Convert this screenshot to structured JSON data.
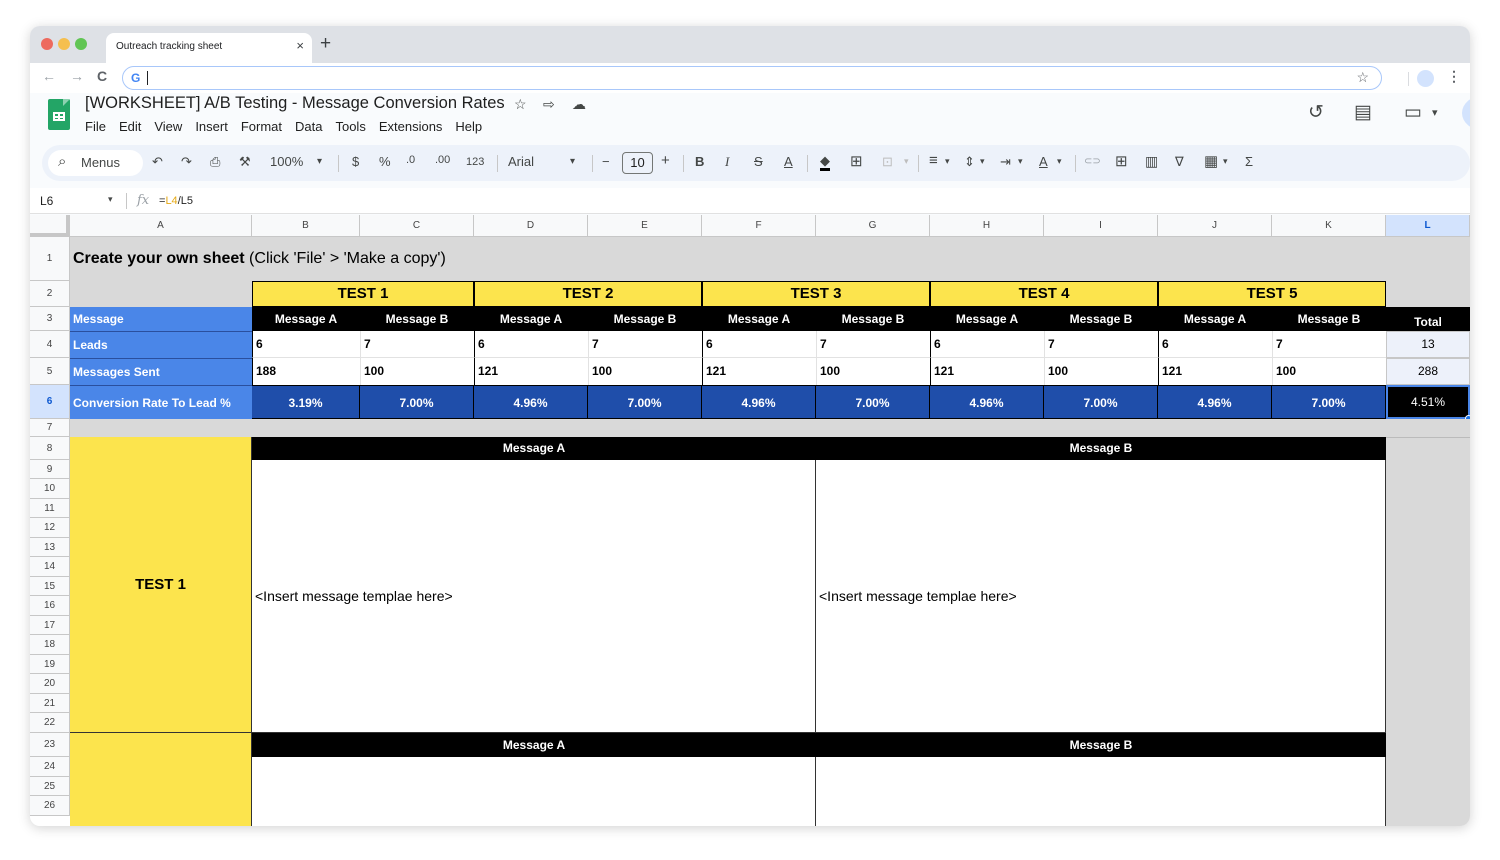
{
  "browser": {
    "tab_title": "Outreach tracking sheet",
    "tab_close": "×",
    "new_tab": "+",
    "back": "←",
    "forward": "→",
    "reload": "C",
    "omnibox_logo": "G",
    "omnibox_value": "",
    "bookmark_star": "☆",
    "menu": "⋮"
  },
  "header": {
    "doc_title": "[WORKSHEET] A/B Testing - Message Conversion Rates",
    "star_icon": "☆",
    "move_icon": "⇨",
    "cloud_icon": "☁",
    "menus": [
      "File",
      "Edit",
      "View",
      "Insert",
      "Format",
      "Data",
      "Tools",
      "Extensions",
      "Help"
    ],
    "history_icon": "↺",
    "comments_icon": "▤",
    "meet_icon": "▭",
    "meet_dropdown": "▾"
  },
  "toolbar": {
    "search_label": "Menus",
    "search_icon": "⌕",
    "undo": "↶",
    "redo": "↷",
    "print": "⎙",
    "paint_format": "⚒",
    "zoom": "100%",
    "dropdown": "▾",
    "currency": "$",
    "percent": "%",
    "decrease_decimal": ".0",
    "increase_decimal": ".00",
    "more_formats": "123",
    "font": "Arial",
    "font_size_decrease": "−",
    "font_size": "10",
    "font_size_increase": "+",
    "bold": "B",
    "italic": "I",
    "strikethrough": "S",
    "text_color": "A",
    "fill_color": "◆",
    "borders": "⊞",
    "merge": "⊡",
    "h_align": "≡",
    "v_align": "⇕",
    "wrap": "⇥",
    "rotate": "A",
    "link": "⊂⊃",
    "comment": "⊞",
    "chart": "▥",
    "filter": "∇",
    "views": "▦",
    "functions": "Σ"
  },
  "formula_bar": {
    "cell_ref": "L6",
    "dropdown": "▾",
    "fx": "fx",
    "formula_eq": "=",
    "formula_ref1": "L4",
    "formula_rest": "/L5"
  },
  "sheet": {
    "columns": [
      "A",
      "B",
      "C",
      "D",
      "E",
      "F",
      "G",
      "H",
      "I",
      "J",
      "K",
      "L"
    ],
    "selected_column": "L",
    "rows": [
      "1",
      "2",
      "3",
      "4",
      "5",
      "6",
      "7",
      "8",
      "9",
      "10",
      "11",
      "12",
      "13",
      "14",
      "15",
      "16",
      "17",
      "18",
      "19",
      "20",
      "21",
      "22",
      "23",
      "24",
      "25",
      "26"
    ],
    "selected_row": "6",
    "title_bold": "Create your own sheet",
    "title_rest": " (Click 'File' > 'Make a copy')",
    "tests": [
      "TEST 1",
      "TEST 2",
      "TEST 3",
      "TEST 4",
      "TEST 5"
    ],
    "row_labels": {
      "message": "Message",
      "leads": "Leads",
      "messages_sent": "Messages Sent",
      "conversion": "Conversion Rate To Lead %"
    },
    "message_headers": [
      "Message A",
      "Message B",
      "Message A",
      "Message B",
      "Message A",
      "Message B",
      "Message A",
      "Message B",
      "Message A",
      "Message B"
    ],
    "total_label": "Total",
    "leads": [
      "6",
      "7",
      "6",
      "7",
      "6",
      "7",
      "6",
      "7",
      "6",
      "7"
    ],
    "messages_sent": [
      "188",
      "100",
      "121",
      "100",
      "121",
      "100",
      "121",
      "100",
      "121",
      "100"
    ],
    "conversion_rates": [
      "3.19%",
      "7.00%",
      "4.96%",
      "7.00%",
      "4.96%",
      "7.00%",
      "4.96%",
      "7.00%",
      "4.96%",
      "7.00%"
    ],
    "total_leads": "13",
    "total_sent": "288",
    "total_conversion": "4.51%",
    "section1": {
      "label": "TEST 1",
      "msg_a_header": "Message A",
      "msg_b_header": "Message B",
      "msg_a_body": "<Insert message templae here>",
      "msg_b_body": "<Insert message templae here>"
    },
    "section2": {
      "msg_a_header": "Message A",
      "msg_b_header": "Message B"
    }
  },
  "colors": {
    "yellow": "#fce44d",
    "label_blue": "#4a86e8",
    "rate_blue": "#1f4eaa",
    "band_gray": "#d9d9d9",
    "header_black": "#000000"
  }
}
